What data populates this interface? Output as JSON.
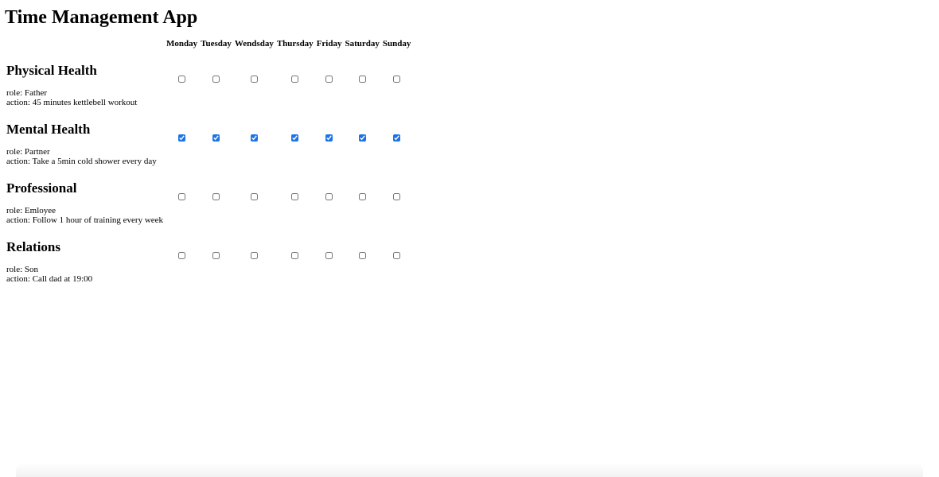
{
  "app": {
    "title": "Time Management App"
  },
  "days": [
    "Monday",
    "Tuesday",
    "Wendsday",
    "Thursday",
    "Friday",
    "Saturday",
    "Sunday"
  ],
  "labels": {
    "role_prefix": "role: ",
    "action_prefix": "action: "
  },
  "areas": [
    {
      "title": "Physical Health",
      "role": "Father",
      "action": "45 minutes kettlebell workout",
      "checked": [
        false,
        false,
        false,
        false,
        false,
        false,
        false
      ]
    },
    {
      "title": "Mental Health",
      "role": "Partner",
      "action": "Take a 5min cold shower every day",
      "checked": [
        true,
        true,
        true,
        true,
        true,
        true,
        true
      ]
    },
    {
      "title": "Professional",
      "role": "Emloyee",
      "action": "Follow 1 hour of training every week",
      "checked": [
        false,
        false,
        false,
        false,
        false,
        false,
        false
      ]
    },
    {
      "title": "Relations",
      "role": "Son",
      "action": "Call dad at 19:00",
      "checked": [
        false,
        false,
        false,
        false,
        false,
        false,
        false
      ]
    }
  ],
  "colors": {
    "accent": "#1a73e8",
    "text": "#000000",
    "background": "#ffffff"
  }
}
